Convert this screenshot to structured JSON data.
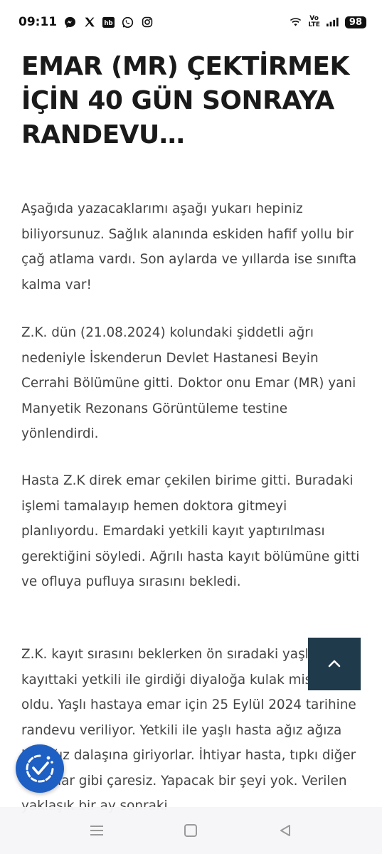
{
  "status_bar": {
    "time": "09:11",
    "notification_icons": [
      "messenger-icon",
      "x-icon",
      "hb-icon",
      "whatsapp-icon",
      "instagram-icon"
    ],
    "network_label_top": "Vo",
    "network_label_bottom": "LTE",
    "battery": "98"
  },
  "article": {
    "title": "EMAR (MR) ÇEKTİRMEK İÇİN 40 GÜN SONRAYA RANDEVU…",
    "paragraphs": [
      "Aşağıda yazacaklarımı aşağı yukarı hepiniz biliyorsunuz. Sağlık alanında eskiden hafif yollu bir çağ atlama vardı. Son aylarda ve yıllarda ise sınıfta kalma var!",
      "Z.K. dün (21.08.2024) kolundaki şiddetli ağrı nedeniyle İskenderun Devlet Hastanesi Beyin Cerrahi Bölümüne gitti. Doktor onu Emar (MR) yani Manyetik Rezonans Görüntüleme testine yönlendirdi.",
      "Hasta Z.K direk emar çekilen birime gitti. Buradaki işlemi tamalayıp hemen doktora gitmeyi planlıyordu. Emardaki yetkili kayıt yaptırılması gerektiğini söyledi. Ağrılı hasta kayıt bölümüne gitti ve ofluya pufluya sırasını bekledi.",
      "Z.K. kayıt sırasını beklerken ön sıradaki yaşlı hasta kayıttaki yetkili ile girdiği diyaloğa kulak misafiri oldu. Yaşlı hastaya emar için 25 Eylül 2024 tarihine randevu veriliyor. Yetkili ile yaşlı hasta ağız ağıza bir ağız dalaşına giriyorlar. İhtiyar hasta, tıpkı diğer hastalar gibi çaresiz. Yapacak bir şeyi yok. Verilen yaklaşık bir ay sonraki"
    ]
  },
  "floating": {
    "scroll_top_icon": "chevron-up-icon",
    "accessibility_icon": "accessibility-icon",
    "scroll_top_color": "#1f3a4b",
    "accessibility_color": "#1e5fc4"
  },
  "nav_bar": {
    "items": [
      "menu-icon",
      "home-icon",
      "back-icon"
    ]
  }
}
